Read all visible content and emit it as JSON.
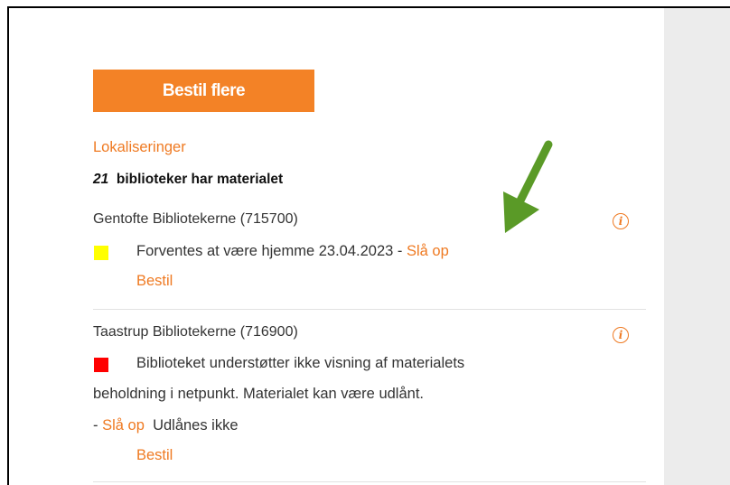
{
  "order_more_label": "Bestil flere",
  "localizations": {
    "heading": "Lokaliseringer",
    "count": "21",
    "count_text": "biblioteker har materialet"
  },
  "libraries": [
    {
      "name": "Gentofte Bibliotekerne (715700)",
      "status_color": "#ffff00",
      "status_text": "Forventes at være hjemme 23.04.2023 - ",
      "lookup_label": "Slå op",
      "order_label": "Bestil"
    },
    {
      "name": "Taastrup Bibliotekerne (716900)",
      "status_color": "#ff0000",
      "status_line1": "Biblioteket understøtter ikke visning af materialets",
      "status_line2": "beholdning i netpunkt. Materialet kan være udlånt.",
      "prefix": "- ",
      "lookup_label": "Slå op",
      "loan_status": "Udlånes ikke",
      "order_label": "Bestil"
    }
  ],
  "icons": {
    "info": "info-circle-icon",
    "arrow": "green-arrow-annotation"
  },
  "colors": {
    "accent": "#ef7a22",
    "button": "#f38226",
    "arrow": "#5a9a27",
    "sidebar": "#ececec"
  }
}
